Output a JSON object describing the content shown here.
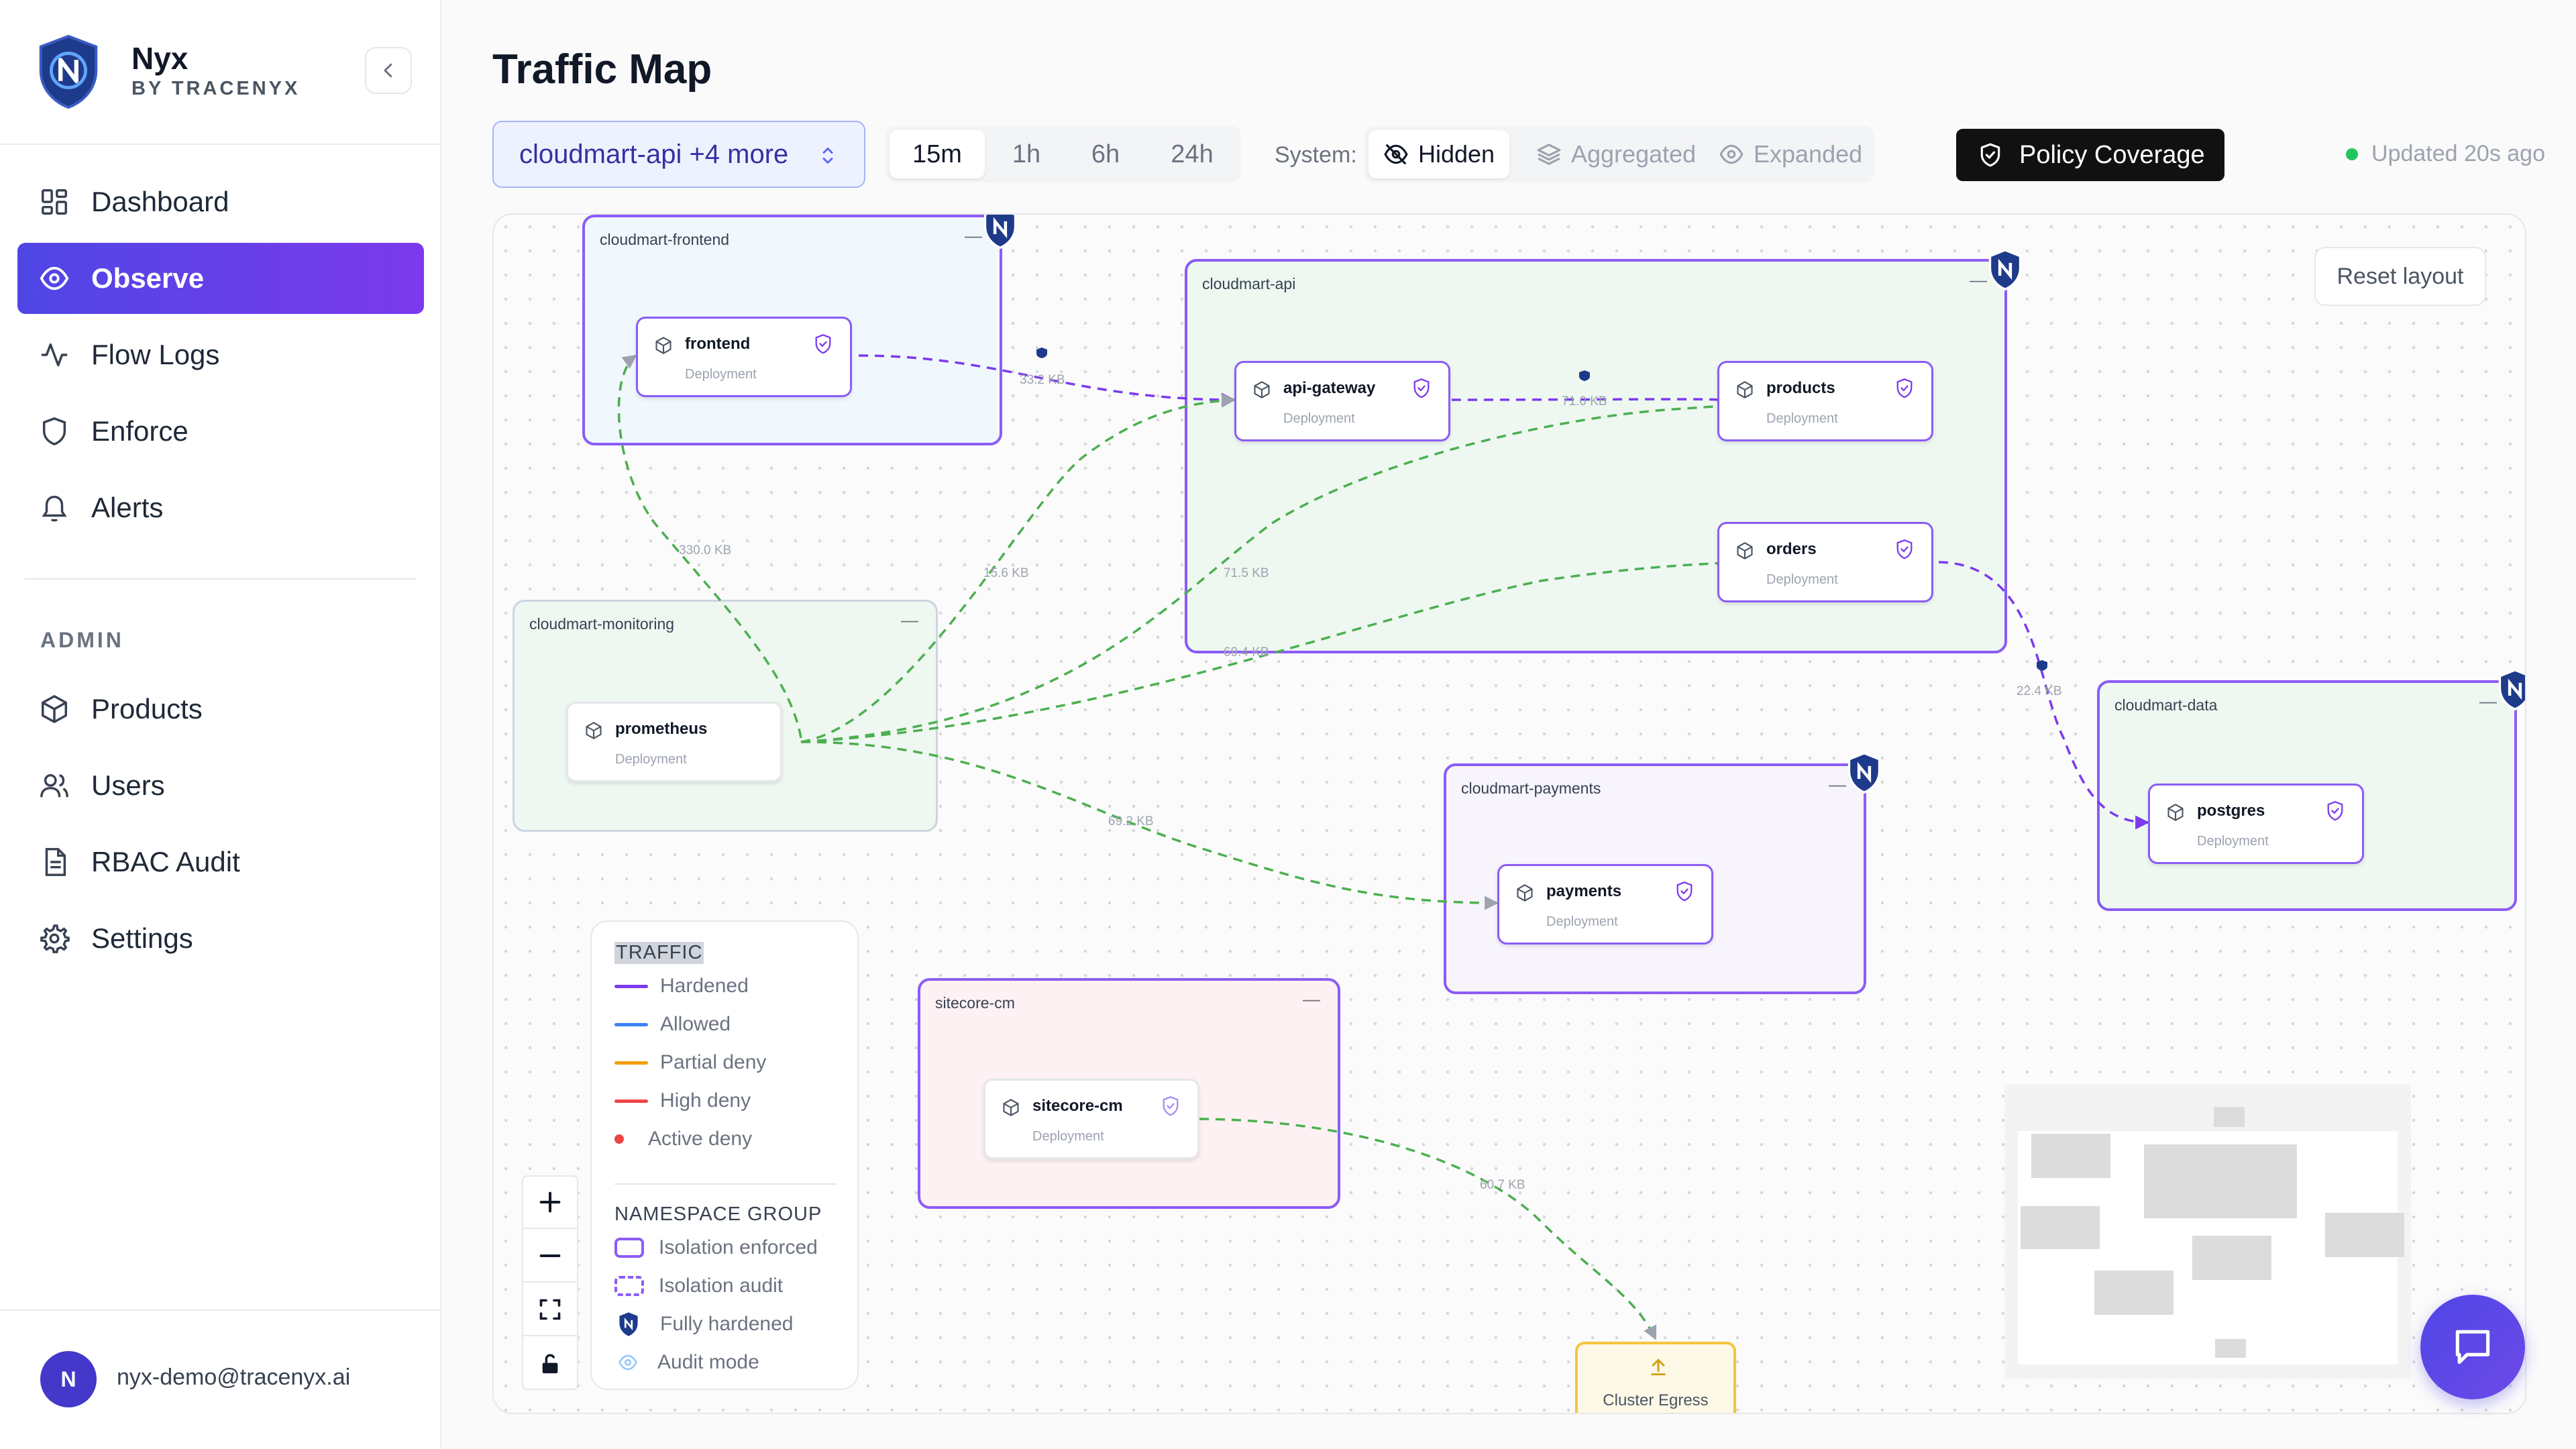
{
  "app": {
    "name": "Nyx",
    "subtitle": "BY TRACENYX"
  },
  "nav": {
    "items": [
      {
        "label": "Dashboard",
        "icon": "grid-icon"
      },
      {
        "label": "Observe",
        "icon": "eye-icon",
        "active": true
      },
      {
        "label": "Flow Logs",
        "icon": "activity-icon"
      },
      {
        "label": "Enforce",
        "icon": "shield-icon"
      },
      {
        "label": "Alerts",
        "icon": "bell-icon"
      }
    ],
    "admin_label": "ADMIN",
    "admin_items": [
      {
        "label": "Products",
        "icon": "box-icon"
      },
      {
        "label": "Users",
        "icon": "users-icon"
      },
      {
        "label": "RBAC Audit",
        "icon": "file-icon"
      },
      {
        "label": "Settings",
        "icon": "gear-icon"
      }
    ]
  },
  "user": {
    "initial": "N",
    "email": "nyx-demo@tracenyx.ai"
  },
  "page": {
    "title": "Traffic Map"
  },
  "toolbar": {
    "namespace_select": "cloudmart-api +4 more",
    "time_ranges": [
      "15m",
      "1h",
      "6h",
      "24h"
    ],
    "selected_time": "15m",
    "system_label": "System:",
    "system_options": [
      "Hidden",
      "Aggregated",
      "Expanded"
    ],
    "selected_system": "Hidden",
    "policy_button": "Policy Coverage",
    "updated": "Updated 20s ago"
  },
  "canvas": {
    "reset_label": "Reset layout",
    "minimize_glyph": "—",
    "namespaces": {
      "frontend": "cloudmart-frontend",
      "api": "cloudmart-api",
      "monitoring": "cloudmart-monitoring",
      "payments": "cloudmart-payments",
      "data": "cloudmart-data",
      "sitecore": "sitecore-cm"
    },
    "workloads": {
      "frontend": {
        "name": "frontend",
        "kind": "Deployment"
      },
      "api_gateway": {
        "name": "api-gateway",
        "kind": "Deployment"
      },
      "products": {
        "name": "products",
        "kind": "Deployment"
      },
      "orders": {
        "name": "orders",
        "kind": "Deployment"
      },
      "prometheus": {
        "name": "prometheus",
        "kind": "Deployment"
      },
      "payments": {
        "name": "payments",
        "kind": "Deployment"
      },
      "postgres": {
        "name": "postgres",
        "kind": "Deployment"
      },
      "sitecore": {
        "name": "sitecore-cm",
        "kind": "Deployment"
      }
    },
    "edge_labels": {
      "frontend_api": "33.2 KB",
      "api_products": "71.0 KB",
      "prom_frontend": "330.0 KB",
      "prom_apigw": "15.6 KB",
      "prom_products": "71.5 KB",
      "prom_orders": "69.4 KB",
      "orders_postgres": "22.4 KB",
      "prom_payments": "69.2 KB",
      "sitecore_egress": "60.7 KB"
    },
    "egress_label": "Cluster Egress"
  },
  "legend": {
    "traffic_title": "TRAFFIC",
    "traffic": [
      {
        "label": "Hardened",
        "color": "#7c3aed"
      },
      {
        "label": "Allowed",
        "color": "#3b82f6"
      },
      {
        "label": "Partial deny",
        "color": "#f59e0b"
      },
      {
        "label": "High deny",
        "color": "#ef4444"
      },
      {
        "label": "Active deny",
        "color": "#ef4444"
      }
    ],
    "group_title": "NAMESPACE GROUP",
    "groups": [
      {
        "label": "Isolation enforced"
      },
      {
        "label": "Isolation audit"
      },
      {
        "label": "Fully hardened"
      },
      {
        "label": "Audit mode"
      }
    ]
  },
  "colors": {
    "hardened": "#7c3aed",
    "allowed_edge": "#4caf50",
    "accent": "#4f46e5",
    "egress": "#f4c542"
  }
}
